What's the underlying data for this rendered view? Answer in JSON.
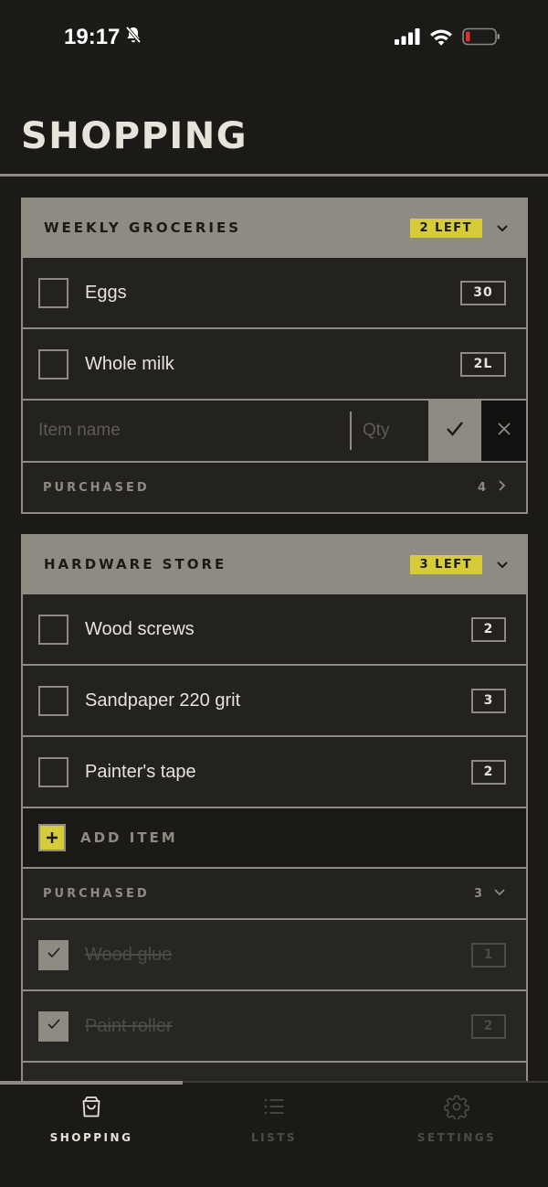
{
  "status_bar": {
    "time": "19:17",
    "icons": [
      "bell-slash-icon",
      "cellular-signal-icon",
      "wifi-icon",
      "battery-low-icon"
    ]
  },
  "header": {
    "title": "SHOPPING"
  },
  "colors": {
    "background": "#1b1a17",
    "card": "#23221f",
    "border": "#8f8b82",
    "accent": "#d6cc3a",
    "muted": "#4d4b46"
  },
  "lists": [
    {
      "title": "WEEKLY GROCERIES",
      "remaining": "2 LEFT",
      "items": [
        {
          "name": "Eggs",
          "qty": "30"
        },
        {
          "name": "Whole milk",
          "qty": "2L"
        }
      ],
      "new_item": {
        "name_placeholder": "Item name",
        "qty_placeholder": "Qty"
      },
      "purchased": {
        "label": "PURCHASED",
        "count": "4"
      }
    },
    {
      "title": "HARDWARE STORE",
      "remaining": "3 LEFT",
      "items": [
        {
          "name": "Wood screws",
          "qty": "2"
        },
        {
          "name": "Sandpaper 220 grit",
          "qty": "3"
        },
        {
          "name": "Painter's tape",
          "qty": "2"
        }
      ],
      "add_item_label": "ADD ITEM",
      "purchased": {
        "label": "PURCHASED",
        "count": "3",
        "items": [
          {
            "name": "Wood glue",
            "qty": "1"
          },
          {
            "name": "Paint roller",
            "qty": "2"
          }
        ]
      }
    }
  ],
  "tab_bar": {
    "active": "shopping",
    "tabs": [
      {
        "label": "SHOPPING",
        "icon": "shopping-bag-icon"
      },
      {
        "label": "LISTS",
        "icon": "list-icon"
      },
      {
        "label": "SETTINGS",
        "icon": "gear-icon"
      }
    ]
  }
}
